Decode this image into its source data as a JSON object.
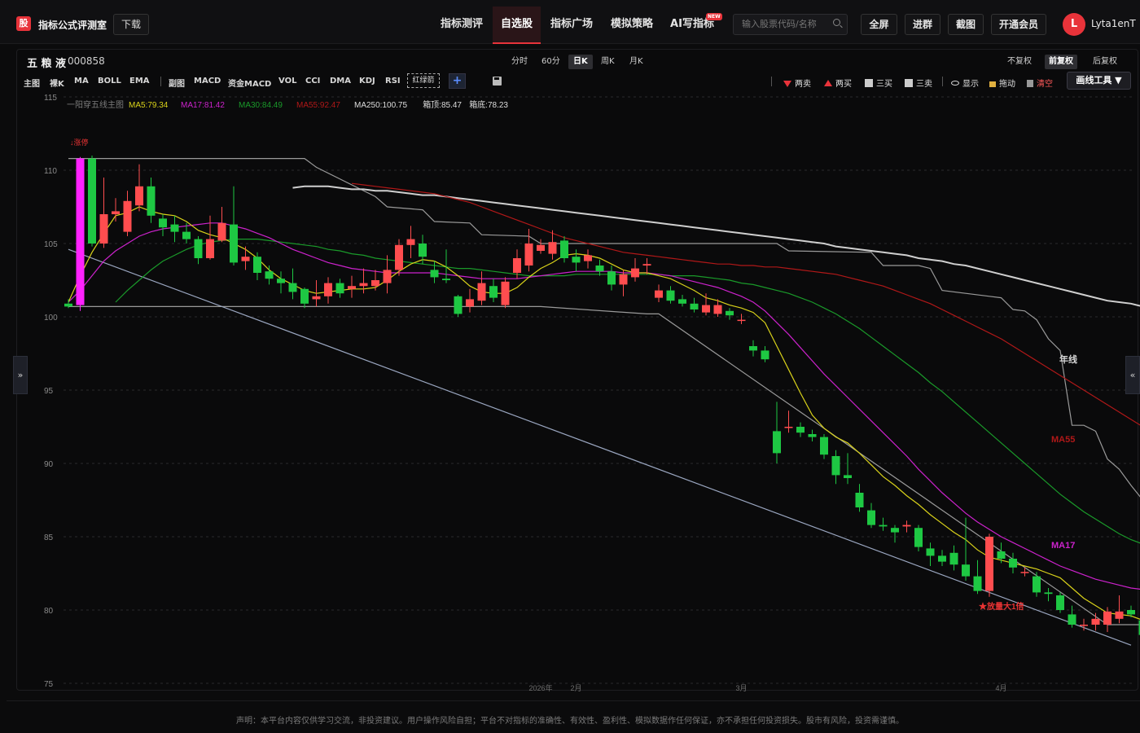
{
  "app": {
    "logo_char": "股",
    "title": "指标公式评测室",
    "download_label": "下载"
  },
  "nav": {
    "items": [
      "指标测评",
      "自选股",
      "指标广场",
      "模拟策略",
      "AI写指标"
    ],
    "active_index": 1,
    "new_badge": "NEW"
  },
  "search": {
    "placeholder": "输入股票代码/名称"
  },
  "toolbar": {
    "fullscreen": "全屏",
    "join_group": "进群",
    "screenshot": "截图",
    "membership": "开通会员"
  },
  "user": {
    "avatar_letter": "L",
    "name": "Lyta1enT"
  },
  "stock": {
    "name": "五 粮 液",
    "code": "000858"
  },
  "periods": {
    "items": [
      "分时",
      "60分",
      "日K",
      "周K",
      "月K"
    ],
    "active_index": 2
  },
  "adjust": {
    "items": [
      "不复权",
      "前复权",
      "后复权"
    ],
    "active_index": 1
  },
  "indicators": {
    "main": [
      "主图",
      "裸K",
      "MA",
      "BOLL",
      "EMA"
    ],
    "sub": [
      "副图",
      "MACD",
      "资金MACD",
      "VOL",
      "CCI",
      "DMA",
      "KDJ",
      "RSI"
    ],
    "highlight": "红绿箭",
    "add": "+"
  },
  "draw_tools": {
    "items": [
      {
        "label": "两卖",
        "icon": "triangle-down-icon"
      },
      {
        "label": "两买",
        "icon": "triangle-up-icon"
      },
      {
        "label": "三买",
        "icon": "pattern-icon"
      },
      {
        "label": "三卖",
        "icon": "pattern-icon"
      },
      {
        "label": "显示",
        "icon": "eye-icon"
      },
      {
        "label": "拖动",
        "icon": "lock-icon"
      },
      {
        "label": "清空",
        "icon": "trash-icon"
      }
    ],
    "menu_label": "画线工具 ▼"
  },
  "colors": {
    "up": "#ff4d4f",
    "down": "#1ec843",
    "ma5": "#d9d21a",
    "ma17": "#cc22cc",
    "ma30": "#1a9a2a",
    "ma55": "#b01818",
    "ma250": "#cfcfcf",
    "bull": "#ff22ff",
    "channel": "#9a9a9a",
    "trend": "#9aa6c0"
  },
  "chart_data": {
    "type": "candlestick",
    "title": "一阳穿五线主图",
    "legend": [
      {
        "name": "MA5",
        "value": "79.34"
      },
      {
        "name": "MA17",
        "value": "81.42"
      },
      {
        "name": "MA30",
        "value": "84.49"
      },
      {
        "name": "MA55",
        "value": "92.47"
      },
      {
        "name": "MA250",
        "value": "100.75"
      },
      {
        "name": "箱顶",
        "value": "85.47"
      },
      {
        "name": "箱底",
        "value": "78.23"
      }
    ],
    "ylim": [
      75,
      115
    ],
    "yticks": [
      75,
      80,
      85,
      90,
      95,
      100,
      105,
      110,
      115
    ],
    "x_labels": [
      "2026年",
      "2月",
      "3月",
      "4月"
    ],
    "line_labels": {
      "ma250": "年线",
      "ma55": "MA55",
      "ma17": "MA17"
    },
    "annotations": {
      "limit_up": "↓涨停",
      "volume_surge": "★放量大1倍"
    },
    "candles": [
      [
        100.9,
        100.7,
        101.2,
        100.6
      ],
      [
        100.8,
        110.8,
        110.9,
        100.4
      ],
      [
        110.8,
        105.0,
        111.0,
        104.8
      ],
      [
        105.0,
        107.0,
        109.5,
        104.7
      ],
      [
        107.0,
        107.2,
        108.1,
        106.5
      ],
      [
        105.8,
        107.9,
        108.6,
        105.5
      ],
      [
        107.6,
        108.9,
        110.4,
        107.2
      ],
      [
        108.9,
        106.9,
        109.5,
        106.4
      ],
      [
        106.7,
        106.1,
        107.0,
        105.5
      ],
      [
        106.3,
        105.8,
        106.9,
        105.1
      ],
      [
        105.8,
        105.3,
        106.4,
        105.0
      ],
      [
        105.3,
        104.0,
        105.5,
        103.6
      ],
      [
        104.0,
        105.3,
        106.9,
        103.9
      ],
      [
        105.2,
        106.4,
        107.5,
        105.1
      ],
      [
        106.3,
        103.7,
        108.9,
        103.5
      ],
      [
        103.8,
        104.1,
        104.8,
        103.2
      ],
      [
        104.1,
        103.0,
        104.4,
        102.5
      ],
      [
        103.1,
        102.6,
        103.5,
        102.2
      ],
      [
        102.6,
        102.3,
        103.1,
        101.6
      ],
      [
        102.3,
        101.7,
        103.3,
        101.2
      ],
      [
        101.9,
        100.9,
        102.0,
        100.6
      ],
      [
        101.2,
        101.4,
        102.5,
        100.7
      ],
      [
        101.4,
        102.3,
        102.7,
        100.9
      ],
      [
        102.3,
        101.6,
        102.6,
        101.3
      ],
      [
        101.9,
        102.1,
        102.8,
        101.3
      ],
      [
        102.1,
        102.3,
        103.3,
        101.6
      ],
      [
        102.1,
        102.5,
        103.2,
        101.8
      ],
      [
        102.3,
        103.2,
        104.2,
        101.6
      ],
      [
        103.2,
        104.9,
        105.3,
        102.8
      ],
      [
        104.9,
        105.3,
        106.2,
        104.0
      ],
      [
        105.0,
        104.1,
        105.6,
        103.6
      ],
      [
        103.2,
        102.7,
        103.8,
        102.3
      ],
      [
        102.6,
        102.5,
        104.6,
        102.3
      ],
      [
        101.4,
        100.2,
        101.5,
        100.0
      ],
      [
        100.7,
        101.2,
        101.9,
        100.3
      ],
      [
        101.1,
        102.3,
        103.1,
        100.8
      ],
      [
        102.1,
        101.3,
        102.6,
        101.0
      ],
      [
        100.8,
        102.4,
        102.7,
        100.6
      ],
      [
        103.0,
        104.0,
        104.6,
        102.6
      ],
      [
        103.5,
        105.0,
        106.0,
        103.1
      ],
      [
        104.5,
        104.9,
        105.3,
        104.3
      ],
      [
        104.3,
        105.1,
        105.9,
        103.9
      ],
      [
        105.2,
        104.0,
        105.5,
        103.7
      ],
      [
        104.1,
        103.7,
        104.6,
        103.1
      ],
      [
        103.8,
        104.2,
        104.6,
        103.3
      ],
      [
        103.5,
        103.1,
        103.9,
        102.8
      ],
      [
        103.1,
        102.2,
        103.5,
        101.8
      ],
      [
        102.2,
        102.9,
        103.2,
        101.4
      ],
      [
        102.7,
        103.3,
        104.0,
        102.4
      ],
      [
        103.5,
        103.6,
        104.0,
        102.9
      ],
      [
        101.3,
        101.8,
        102.2,
        101.0
      ],
      [
        101.8,
        101.1,
        102.1,
        100.9
      ],
      [
        101.2,
        100.9,
        101.5,
        100.7
      ],
      [
        100.9,
        100.5,
        101.3,
        100.3
      ],
      [
        100.3,
        100.8,
        101.6,
        100.1
      ],
      [
        100.2,
        100.8,
        101.2,
        100.0
      ],
      [
        100.4,
        100.1,
        100.6,
        99.8
      ],
      [
        99.8,
        99.8,
        100.2,
        99.5
      ],
      [
        98.0,
        97.7,
        98.4,
        97.3
      ],
      [
        97.7,
        97.1,
        98.0,
        96.9
      ],
      [
        92.2,
        90.7,
        94.2,
        90.0
      ],
      [
        92.5,
        92.5,
        93.6,
        92.1
      ],
      [
        92.5,
        92.1,
        92.8,
        91.8
      ],
      [
        92.0,
        91.8,
        92.3,
        91.5
      ],
      [
        91.8,
        90.6,
        92.0,
        90.3
      ],
      [
        90.5,
        89.2,
        90.9,
        88.6
      ],
      [
        89.2,
        89.0,
        90.7,
        88.6
      ],
      [
        88.0,
        87.0,
        88.6,
        86.7
      ],
      [
        86.8,
        85.8,
        87.3,
        85.6
      ],
      [
        85.8,
        85.7,
        86.3,
        85.4
      ],
      [
        85.6,
        85.3,
        85.8,
        84.6
      ],
      [
        85.7,
        85.8,
        86.1,
        85.3
      ],
      [
        85.6,
        84.3,
        85.8,
        84.0
      ],
      [
        84.2,
        83.7,
        84.6,
        83.0
      ],
      [
        83.7,
        83.3,
        84.1,
        83.0
      ],
      [
        83.9,
        83.1,
        84.4,
        82.7
      ],
      [
        83.1,
        82.3,
        86.3,
        82.0
      ],
      [
        82.3,
        81.3,
        83.4,
        81.1
      ],
      [
        81.3,
        85.0,
        85.2,
        80.9
      ],
      [
        84.0,
        83.5,
        84.6,
        83.2
      ],
      [
        83.5,
        82.9,
        83.9,
        82.5
      ],
      [
        82.6,
        82.6,
        82.9,
        82.3
      ],
      [
        82.3,
        81.2,
        82.6,
        80.9
      ],
      [
        81.2,
        81.1,
        81.5,
        80.6
      ],
      [
        81.0,
        80.0,
        81.2,
        79.8
      ],
      [
        79.7,
        79.0,
        80.3,
        78.8
      ],
      [
        79.0,
        79.0,
        79.4,
        78.6
      ],
      [
        79.0,
        79.4,
        79.8,
        78.6
      ],
      [
        79.0,
        79.9,
        80.2,
        78.5
      ],
      [
        79.4,
        79.9,
        81.0,
        79.1
      ],
      [
        80.0,
        79.7,
        80.3,
        79.5
      ],
      [
        79.3,
        78.3,
        79.4,
        78.1
      ]
    ],
    "ma5": [
      101.0,
      102.8,
      104.4,
      105.7,
      106.9,
      107.1,
      107.5,
      107.2,
      107.0,
      106.9,
      106.5,
      105.9,
      105.6,
      105.4,
      105.0,
      104.6,
      104.0,
      103.2,
      102.6,
      102.2,
      101.8,
      101.6,
      101.7,
      101.8,
      101.9,
      101.9,
      102.0,
      102.5,
      103.1,
      103.6,
      103.9,
      103.8,
      103.4,
      102.8,
      102.1,
      101.7,
      101.6,
      101.6,
      102.0,
      102.7,
      103.3,
      103.7,
      104.2,
      104.3,
      104.2,
      104.0,
      103.6,
      103.2,
      103.0,
      103.0,
      102.8,
      102.6,
      102.2,
      101.8,
      101.3,
      101.1,
      100.8,
      100.6,
      100.3,
      99.6,
      98.0,
      96.4,
      94.8,
      93.3,
      92.4,
      91.8,
      91.4,
      90.7,
      89.9,
      89.1,
      88.5,
      87.8,
      87.2,
      86.5,
      85.9,
      85.3,
      84.8,
      84.1,
      83.6,
      83.4,
      83.2,
      83.0,
      82.8,
      82.5,
      82.2,
      81.5,
      80.8,
      80.3,
      79.8,
      79.7,
      79.6,
      79.3
    ],
    "ma17": [
      101.0,
      101.8,
      102.8,
      103.8,
      104.5,
      105.0,
      105.5,
      105.8,
      106.0,
      106.1,
      106.2,
      106.3,
      106.4,
      106.4,
      106.2,
      106.0,
      105.7,
      105.4,
      105.0,
      104.6,
      104.3,
      104.0,
      103.7,
      103.5,
      103.3,
      103.2,
      103.1,
      103.0,
      103.0,
      103.0,
      103.0,
      103.0,
      102.9,
      102.8,
      102.7,
      102.6,
      102.6,
      102.6,
      102.6,
      102.7,
      102.8,
      102.9,
      103.0,
      103.1,
      103.1,
      103.1,
      103.1,
      103.0,
      103.0,
      103.0,
      102.9,
      102.8,
      102.6,
      102.4,
      102.2,
      102.0,
      101.7,
      101.4,
      101.0,
      100.4,
      99.6,
      98.8,
      97.9,
      97.0,
      96.1,
      95.3,
      94.5,
      93.7,
      92.9,
      92.1,
      91.3,
      90.5,
      89.6,
      88.8,
      88.0,
      87.3,
      86.6,
      86.0,
      85.5,
      85.0,
      84.6,
      84.2,
      83.8,
      83.4,
      83.0,
      82.7,
      82.4,
      82.1,
      81.9,
      81.7,
      81.5,
      81.4
    ],
    "ma30": [
      101.0,
      101.8,
      102.5,
      103.2,
      103.8,
      104.2,
      104.6,
      104.9,
      105.1,
      105.2,
      105.3,
      105.3,
      105.3,
      105.2,
      105.1,
      105.0,
      104.9,
      104.8,
      104.6,
      104.5,
      104.3,
      104.2,
      104.0,
      103.9,
      103.8,
      103.7,
      103.6,
      103.5,
      103.4,
      103.3,
      103.3,
      103.2,
      103.1,
      103.0,
      102.9,
      102.8,
      102.8,
      102.8,
      102.8,
      102.9,
      102.9,
      102.9,
      102.9,
      102.9,
      102.9,
      102.9,
      102.9,
      102.8,
      102.8,
      102.8,
      102.7,
      102.6,
      102.5,
      102.3,
      102.2,
      102.0,
      101.8,
      101.6,
      101.3,
      101.0,
      100.6,
      100.2,
      99.7,
      99.2,
      98.6,
      98.0,
      97.4,
      96.8,
      96.2,
      95.5,
      94.9,
      94.2,
      93.5,
      92.8,
      92.1,
      91.4,
      90.7,
      90.0,
      89.3,
      88.6,
      87.9,
      87.3,
      86.7,
      86.2,
      85.7,
      85.2,
      84.8,
      84.5
    ],
    "ma55": [
      109.1,
      109.0,
      108.9,
      108.8,
      108.7,
      108.6,
      108.5,
      108.4,
      108.2,
      108.0,
      107.8,
      107.5,
      107.2,
      106.9,
      106.6,
      106.3,
      106.0,
      105.7,
      105.4,
      105.2,
      105.0,
      104.8,
      104.6,
      104.4,
      104.3,
      104.2,
      104.1,
      104.0,
      103.9,
      103.8,
      103.7,
      103.6,
      103.6,
      103.5,
      103.5,
      103.4,
      103.4,
      103.3,
      103.2,
      103.1,
      103.0,
      102.9,
      102.7,
      102.5,
      102.3,
      102.1,
      101.8,
      101.5,
      101.2,
      100.9,
      100.5,
      100.1,
      99.7,
      99.3,
      98.9,
      98.5,
      98.0,
      97.5,
      97.0,
      96.5,
      96.0,
      95.5,
      95.0,
      94.5,
      94.0,
      93.5,
      93.0,
      92.5
    ],
    "ma250": [
      108.8,
      108.9,
      108.9,
      108.9,
      108.8,
      108.7,
      108.7,
      108.6,
      108.6,
      108.5,
      108.4,
      108.3,
      108.3,
      108.2,
      108.1,
      108.0,
      107.9,
      107.8,
      107.7,
      107.6,
      107.5,
      107.4,
      107.3,
      107.2,
      107.1,
      107.0,
      106.9,
      106.8,
      106.7,
      106.6,
      106.5,
      106.4,
      106.3,
      106.2,
      106.1,
      106.0,
      105.9,
      105.8,
      105.7,
      105.6,
      105.5,
      105.4,
      105.3,
      105.2,
      105.1,
      105.0,
      104.8,
      104.7,
      104.6,
      104.5,
      104.4,
      104.3,
      104.2,
      104.0,
      103.9,
      103.8,
      103.6,
      103.5,
      103.3,
      103.1,
      102.9,
      102.7,
      102.5,
      102.3,
      102.1,
      101.9,
      101.7,
      101.5,
      101.3,
      101.1,
      101.0,
      100.9,
      100.7
    ],
    "box_top": [
      [
        0,
        110.8
      ],
      [
        20,
        110.8
      ],
      [
        21,
        110.2
      ],
      [
        26,
        108.2
      ],
      [
        27,
        107.5
      ],
      [
        30,
        107.3
      ],
      [
        31,
        106.5
      ],
      [
        34,
        106.4
      ],
      [
        35,
        105.6
      ],
      [
        39,
        105.5
      ],
      [
        40,
        105.0
      ],
      [
        60,
        105.0
      ],
      [
        61,
        104.5
      ],
      [
        68,
        104.4
      ],
      [
        69,
        103.5
      ],
      [
        72,
        103.5
      ],
      [
        73,
        103.3
      ],
      [
        74,
        101.8
      ],
      [
        78,
        101.4
      ],
      [
        79,
        101.3
      ],
      [
        80,
        100.5
      ],
      [
        81,
        100.4
      ],
      [
        82,
        99.8
      ],
      [
        83,
        98.5
      ],
      [
        84,
        97.7
      ],
      [
        85,
        92.6
      ],
      [
        86,
        92.6
      ],
      [
        87,
        92.2
      ],
      [
        88,
        90.3
      ],
      [
        89,
        89.6
      ],
      [
        90,
        88.5
      ],
      [
        91,
        87.5
      ],
      [
        92,
        86.4
      ],
      [
        93,
        85.8
      ],
      [
        94,
        85.5
      ]
    ],
    "box_bottom": [
      [
        0,
        100.7
      ],
      [
        40,
        100.7
      ],
      [
        49,
        100.2
      ],
      [
        50,
        100.2
      ],
      [
        88,
        79.0
      ],
      [
        91,
        79.0
      ],
      [
        92,
        78.2
      ]
    ],
    "trend_line": [
      [
        0,
        104.6
      ],
      [
        90,
        77.6
      ]
    ]
  },
  "footer": {
    "disclaimer": "声明：本平台内容仅供学习交流，非投资建议。用户操作风险自担；平台不对指标的准确性、有效性、盈利性、模拟数据作任何保证，亦不承担任何投资损失。股市有风险，投资需谨慎。"
  }
}
